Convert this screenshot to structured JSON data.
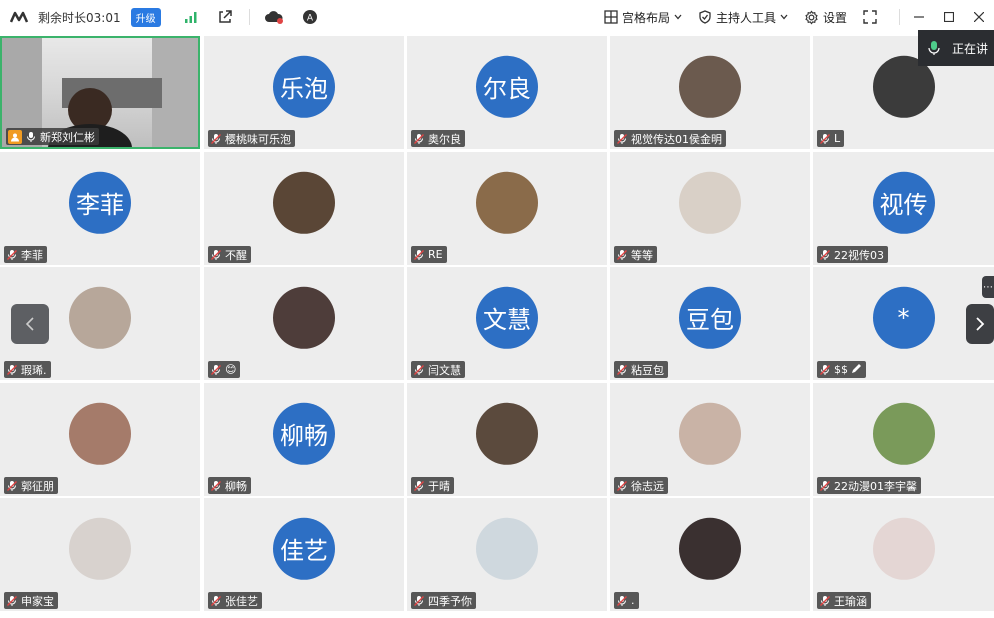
{
  "topbar": {
    "timer": "剩余时长03:01",
    "upgrade": "升级",
    "layout": "宫格布局",
    "host_tools": "主持人工具",
    "settings": "设置"
  },
  "speaking": "正在讲",
  "participants": [
    {
      "name": "新郑刘仁彬",
      "avatar_text": "",
      "video": true
    },
    {
      "name": "樱桃味可乐泡",
      "avatar_text": "乐泡"
    },
    {
      "name": "奥尔良",
      "avatar_text": "尔良"
    },
    {
      "name": "视觉传达01侯金明",
      "avatar_text": ""
    },
    {
      "name": "L",
      "avatar_text": ""
    },
    {
      "name": "李菲",
      "avatar_text": "李菲"
    },
    {
      "name": "不醒",
      "avatar_text": ""
    },
    {
      "name": "RE",
      "avatar_text": ""
    },
    {
      "name": "等等",
      "avatar_text": ""
    },
    {
      "name": "22视传03",
      "avatar_text": "视传"
    },
    {
      "name": "瑕琋.",
      "avatar_text": ""
    },
    {
      "name": "😊",
      "avatar_text": ""
    },
    {
      "name": "闫文慧",
      "avatar_text": "文慧"
    },
    {
      "name": "粘豆包",
      "avatar_text": "豆包"
    },
    {
      "name": "$$",
      "avatar_text": "*"
    },
    {
      "name": "郭征朋",
      "avatar_text": ""
    },
    {
      "name": "柳畅",
      "avatar_text": "柳畅"
    },
    {
      "name": "于晴",
      "avatar_text": ""
    },
    {
      "name": "徐志远",
      "avatar_text": ""
    },
    {
      "name": "22动漫01李宇馨",
      "avatar_text": ""
    },
    {
      "name": "申家宝",
      "avatar_text": ""
    },
    {
      "name": "张佳艺",
      "avatar_text": "佳艺"
    },
    {
      "name": "四季予你",
      "avatar_text": ""
    },
    {
      "name": ".",
      "avatar_text": ""
    },
    {
      "name": "王瑜涵",
      "avatar_text": ""
    }
  ],
  "photo_colors": [
    "#6b5a4e",
    "#3b3b3b",
    "#5a4636",
    "#8a6b4a",
    "#d9d0c7",
    "#b7a79a",
    "#4e3d3a",
    "#a57b6a",
    "#5b4a3d",
    "#c9b3a6",
    "#7a9a5a",
    "#d8d2ce",
    "#cfd8de",
    "#3a3030",
    "#e4d6d4",
    "#9a8a7a"
  ]
}
